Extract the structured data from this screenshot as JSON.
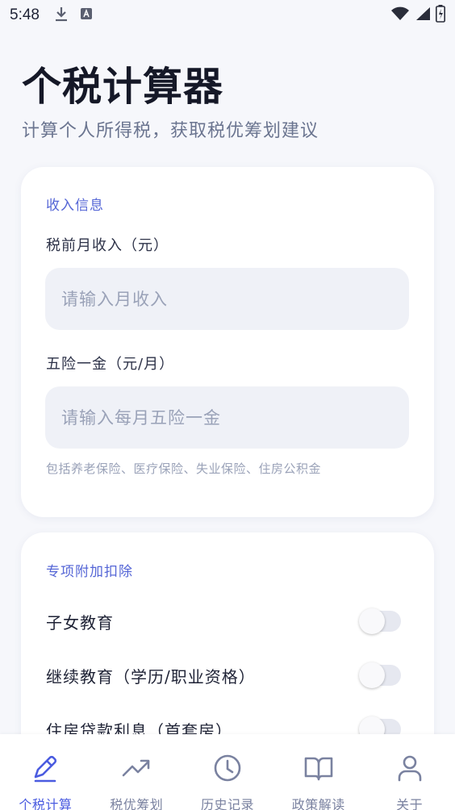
{
  "status_bar": {
    "time": "5:48",
    "icons": [
      "download-icon",
      "a-box-icon",
      "wifi-icon",
      "signal-icon",
      "battery-charging-icon"
    ]
  },
  "header": {
    "title": "个税计算器",
    "subtitle": "计算个人所得税，获取税优筹划建议"
  },
  "income_card": {
    "section_title": "收入信息",
    "monthly_income": {
      "label": "税前月收入（元）",
      "placeholder": "请输入月收入",
      "value": ""
    },
    "insurance": {
      "label": "五险一金（元/月）",
      "placeholder": "请输入每月五险一金",
      "value": "",
      "hint": "包括养老保险、医疗保险、失业保险、住房公积金"
    }
  },
  "deduction_card": {
    "section_title": "专项附加扣除",
    "items": [
      {
        "label": "子女教育",
        "enabled": false
      },
      {
        "label": "继续教育（学历/职业资格）",
        "enabled": false
      },
      {
        "label": "住房贷款利息（首套房）",
        "enabled": false
      }
    ]
  },
  "bottom_nav": {
    "items": [
      {
        "label": "个税计算",
        "icon": "pencil-icon",
        "active": true
      },
      {
        "label": "税优筹划",
        "icon": "trending-up-icon",
        "active": false
      },
      {
        "label": "历史记录",
        "icon": "clock-icon",
        "active": false
      },
      {
        "label": "政策解读",
        "icon": "book-icon",
        "active": false
      },
      {
        "label": "关于",
        "icon": "person-icon",
        "active": false
      }
    ],
    "active_color": "#4a5be0",
    "inactive_color": "#7a82a0"
  }
}
